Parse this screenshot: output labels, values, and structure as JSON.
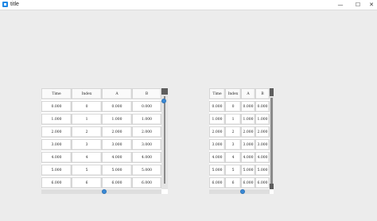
{
  "window": {
    "title": "title",
    "minimize_glyph": "—",
    "maximize_glyph": "☐",
    "close_glyph": "✕"
  },
  "table_left": {
    "columns": [
      "Time",
      "Index",
      "A",
      "B"
    ],
    "rows": [
      [
        "0.000",
        "0",
        "0.000",
        "0.000"
      ],
      [
        "1.000",
        "1",
        "1.000",
        "1.000"
      ],
      [
        "2.000",
        "2",
        "2.000",
        "2.000"
      ],
      [
        "3.000",
        "3",
        "3.000",
        "3.000"
      ],
      [
        "4.000",
        "4",
        "4.000",
        "4.000"
      ],
      [
        "5.000",
        "5",
        "5.000",
        "5.000"
      ],
      [
        "6.000",
        "6",
        "6.000",
        "6.000"
      ]
    ]
  },
  "table_right": {
    "columns": [
      "Time",
      "Index",
      "A",
      "B"
    ],
    "rows": [
      [
        "0.000",
        "0",
        "0.000",
        "0.000"
      ],
      [
        "1.000",
        "1",
        "1.000",
        "1.000"
      ],
      [
        "2.000",
        "2",
        "2.000",
        "2.000"
      ],
      [
        "3.000",
        "3",
        "3.000",
        "3.000"
      ],
      [
        "4.000",
        "4",
        "4.000",
        "4.000"
      ],
      [
        "5.000",
        "5",
        "5.000",
        "5.000"
      ],
      [
        "6.000",
        "6",
        "6.000",
        "6.000"
      ]
    ]
  },
  "colors": {
    "window_bg": "#ececec",
    "accent": "#3a8ad6",
    "app_icon": "#1e88e5"
  }
}
